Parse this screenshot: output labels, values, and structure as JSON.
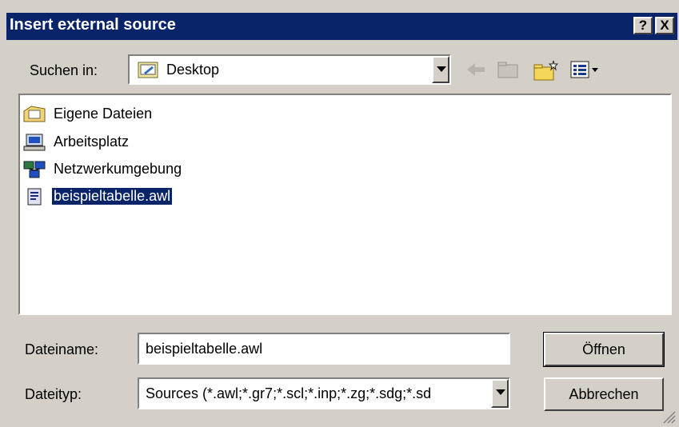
{
  "window": {
    "title": "Insert external source",
    "help_glyph": "?",
    "close_glyph": "X"
  },
  "look_in": {
    "label": "Suchen in:",
    "value": "Desktop",
    "value_icon": "desktop-folder-icon"
  },
  "toolbar": {
    "icons": [
      "back-arrow-icon",
      "up-folder-icon",
      "new-folder-icon",
      "view-menu-icon"
    ]
  },
  "files": [
    {
      "name": "Eigene Dateien",
      "icon": "my-documents-icon",
      "selected": false
    },
    {
      "name": "Arbeitsplatz",
      "icon": "my-computer-icon",
      "selected": false
    },
    {
      "name": "Netzwerkumgebung",
      "icon": "network-icon",
      "selected": false
    },
    {
      "name": "beispieltabelle.awl",
      "icon": "awl-file-icon",
      "selected": true
    }
  ],
  "filename": {
    "label": "Dateiname:",
    "value": "beispieltabelle.awl"
  },
  "filetype": {
    "label": "Dateityp:",
    "value": "Sources (*.awl;*.gr7;*.scl;*.inp;*.zg;*.sdg;*.sd"
  },
  "buttons": {
    "open": "Öffnen",
    "cancel": "Abbrechen"
  },
  "colors": {
    "titlebar": "#0a246a",
    "selection": "#0a246a",
    "face": "#d4d0c8"
  }
}
